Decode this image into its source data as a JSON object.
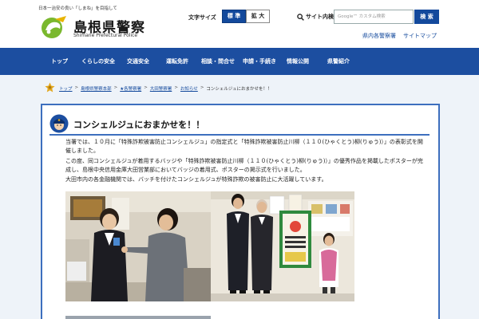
{
  "header": {
    "tagline": "日本一治安の良い「しまね」を目指して",
    "logo_text": "島根県警察",
    "logo_sub": "Shimane Prefectural Police",
    "font_size_label": "文字サイズ",
    "font_size_standard": "標 準",
    "font_size_large": "拡 大",
    "site_search_label": "サイト内検索",
    "search_placeholder": "Google™ カスタム検索",
    "search_button": "検 索",
    "links": [
      "県内各警察署",
      "サイトマップ"
    ]
  },
  "nav": {
    "items": [
      "トップ",
      "くらしの安全",
      "交通安全",
      "運転免許",
      "相談・問合せ",
      "申請・手続き",
      "情報公開",
      "県警紹介"
    ]
  },
  "breadcrumb": {
    "links": [
      "トップ",
      "島根県警察本部",
      "★各警察署",
      "大田警察署",
      "お知らせ"
    ],
    "current": "コンシェルジュにおまかせを！！"
  },
  "article": {
    "title": "コンシェルジュにおまかせを！！",
    "paragraphs": [
      "当署では、１０月に「特殊詐欺被害防止コンシェルジュ」の指定式と「特殊詐欺被害防止川柳（１１０(ひゃくとう)柳(りゅう)）」の表彰式を開催しました。",
      "この度、同コンシェルジュが着用するバッジや「特殊詐欺被害防止川柳（１１０(ひゃくとう)柳(りゅう)）」の優秀作品を掲載したポスターが完成し、島根中央信用金庫大田営業部においてバッジの着用式、ポスターの掲示式を行いました。",
      "大田市内の各金融機関では、バッチを付けたコンシェルジュが特殊詐欺の被害防止に大活躍しています。"
    ]
  },
  "colors": {
    "brand_blue": "#1c4ea0",
    "link_blue": "#13499c",
    "frame_blue": "#3d6fbe",
    "logo_green": "#7ab82e",
    "page_bg": "#eef3f9"
  },
  "icons": [
    "shimane-police-logo-icon",
    "search-icon",
    "prefecture-emblem-icon",
    "police-officer-icon"
  ]
}
